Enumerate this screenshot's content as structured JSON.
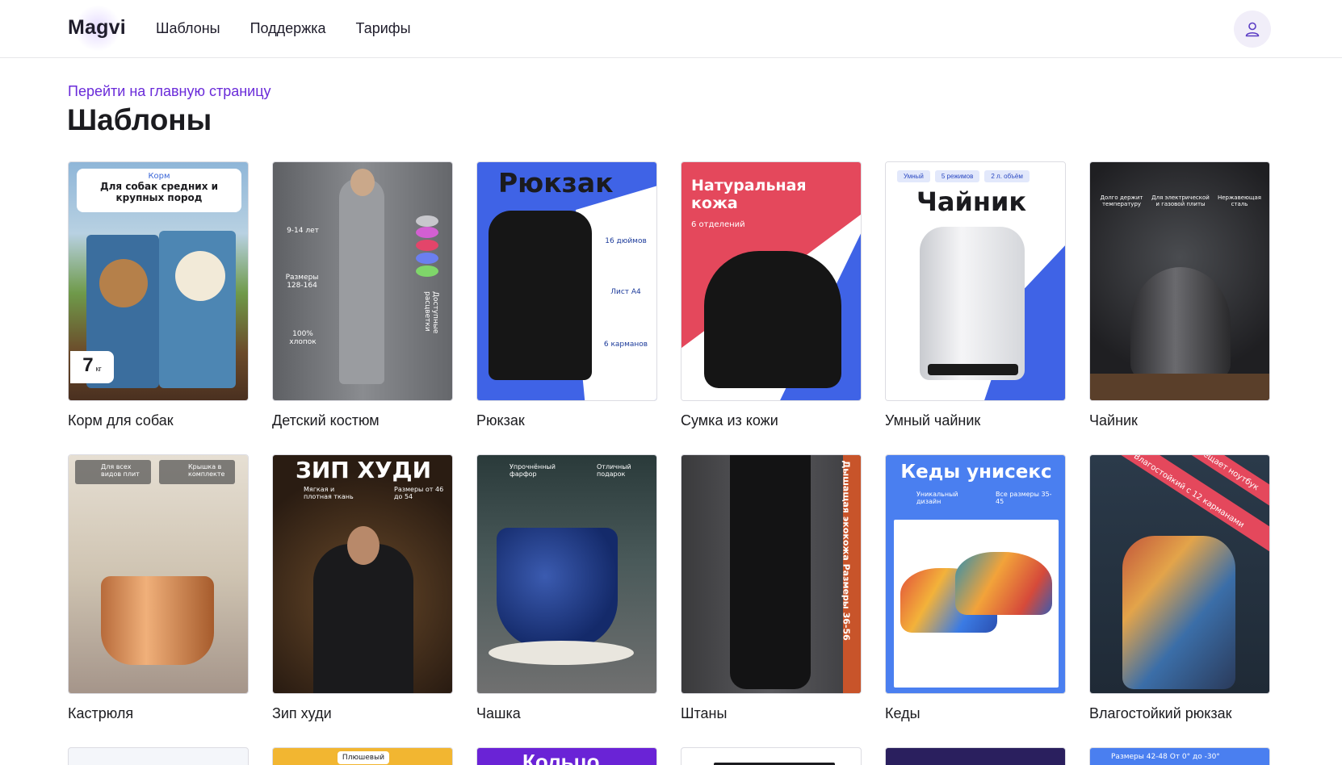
{
  "header": {
    "logo": "Magvi",
    "nav": [
      "Шаблоны",
      "Поддержка",
      "Тарифы"
    ]
  },
  "breadcrumb": {
    "back_link": "Перейти на главную страницу"
  },
  "page": {
    "title": "Шаблоны"
  },
  "templates": [
    {
      "name": "Корм для собак",
      "overlay": {
        "tag": "Корм",
        "headline": "Для собак средних и крупных пород",
        "weight": "7",
        "unit": "кг"
      }
    },
    {
      "name": "Детский костюм",
      "overlay": {
        "age": "9-14 лет",
        "sizes": "Размеры 128-164",
        "fabric": "100% хлопок",
        "colors": "Доступные расцветки"
      }
    },
    {
      "name": "Рюкзак",
      "overlay": {
        "headline": "Рюкзак",
        "f1": "16 дюймов",
        "f2": "Лист А4",
        "f3": "6 карманов"
      }
    },
    {
      "name": "Сумка из кожи",
      "overlay": {
        "headline": "Натуральная кожа",
        "sub": "6 отделений"
      }
    },
    {
      "name": "Умный чайник",
      "overlay": {
        "b1": "Умный",
        "b2": "5 режимов",
        "b3": "2 л. объём",
        "headline": "Чайник"
      }
    },
    {
      "name": "Чайник",
      "overlay": {
        "f1": "Долго держит температуру",
        "f2": "Для электрической и газовой плиты",
        "f3": "Нержавеющая сталь"
      }
    },
    {
      "name": "Кастрюля",
      "overlay": {
        "f1": "Для всех видов плит",
        "f2": "Крышка в комплекте"
      }
    },
    {
      "name": "Зип худи",
      "overlay": {
        "headline": "ЗИП ХУДИ",
        "f1": "Мягкая и плотная ткань",
        "f2": "Размеры от 46 до 54"
      }
    },
    {
      "name": "Чашка",
      "overlay": {
        "f1": "Упрочнённый фарфор",
        "f2": "Отличный подарок"
      }
    },
    {
      "name": "Штаны",
      "overlay": {
        "side": "Дышащая экокожа  Размеры 36-56"
      }
    },
    {
      "name": "Кеды",
      "overlay": {
        "headline": "Кеды унисекс",
        "f1": "Уникальный дизайн",
        "f2": "Все размеры 35-45"
      }
    },
    {
      "name": "Влагостойкий рюкзак",
      "overlay": {
        "r1": "Влагостойкий с 12 карманами",
        "r2": "Вмещает ноутбук"
      }
    }
  ],
  "partial_row": {
    "t2": "Плюшевый",
    "t3": "Кольцо",
    "t6": "Размеры 42-48  От 0° до -30°"
  },
  "colors": {
    "accent": "#6a2bd9",
    "blue": "#3f63e6",
    "red": "#e4485c",
    "dark": "#1f1f22"
  }
}
